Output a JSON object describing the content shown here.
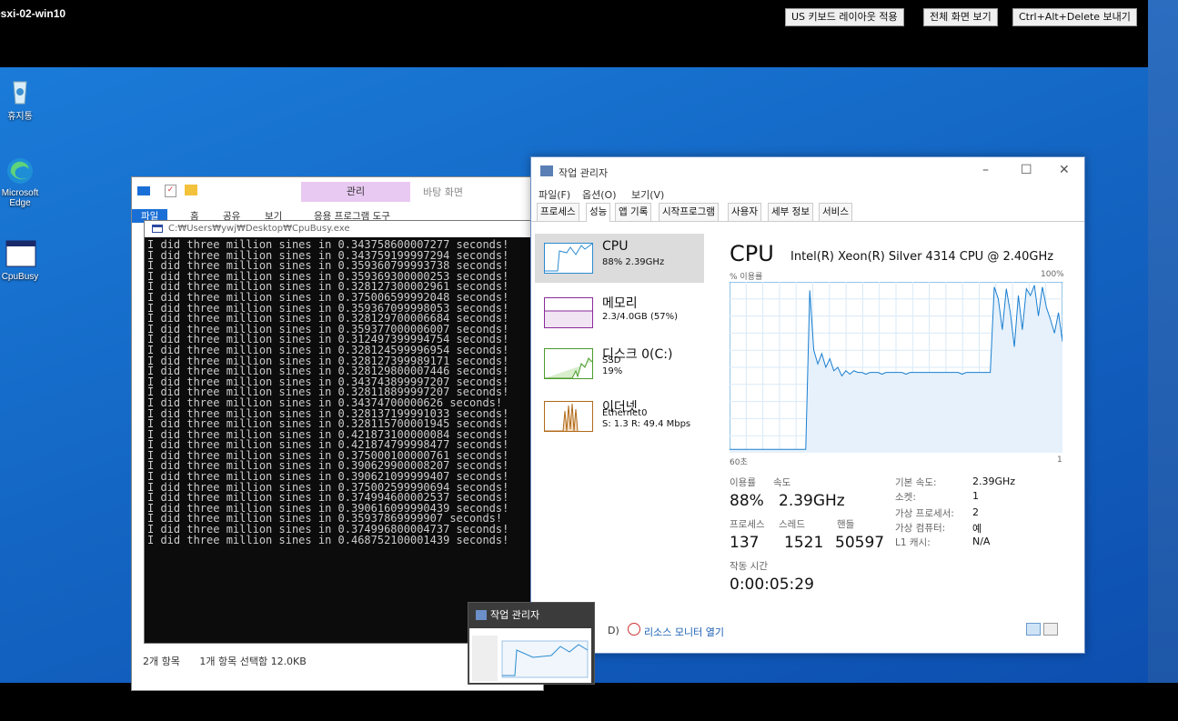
{
  "vm": {
    "title": "esxi-02-win10",
    "buttons": [
      "US 키보드 레이아웃 적용",
      "전체 화면 보기",
      "Ctrl+Alt+Delete 보내기"
    ]
  },
  "desktop": {
    "icons": [
      "휴지통",
      "Microsoft Edge",
      "CpuBusy"
    ]
  },
  "explorer": {
    "context_tab": "관리",
    "context_tab2": "바탕 화면",
    "ribbon_tabs": [
      "파일",
      "홈",
      "공유",
      "보기",
      "응용 프로그램 도구"
    ],
    "status_items": "2개 항목",
    "status_selected": "1개 항목 선택함 12.0KB"
  },
  "console": {
    "title": "C:₩Users₩ywj₩Desktop₩CpuBusy.exe",
    "lines": [
      "I did three million sines in 0.343758600007277 seconds!",
      "I did three million sines in 0.343759199997294 seconds!",
      "I did three million sines in 0.359360799993738 seconds!",
      "I did three million sines in 0.359369300000253 seconds!",
      "I did three million sines in 0.328127300002961 seconds!",
      "I did three million sines in 0.375006599992048 seconds!",
      "I did three million sines in 0.359367099998053 seconds!",
      "I did three million sines in 0.328129700006684 seconds!",
      "I did three million sines in 0.359377000006007 seconds!",
      "I did three million sines in 0.312497399994754 seconds!",
      "I did three million sines in 0.328124599996954 seconds!",
      "I did three million sines in 0.328127399989171 seconds!",
      "I did three million sines in 0.328129800007446 seconds!",
      "I did three million sines in 0.343743899997207 seconds!",
      "I did three million sines in 0.328118899997207 seconds!",
      "I did three million sines in 0.34374700000626 seconds!",
      "I did three million sines in 0.328137199991033 seconds!",
      "I did three million sines in 0.328115700001945 seconds!",
      "I did three million sines in 0.421873100000084 seconds!",
      "I did three million sines in 0.421874799998477 seconds!",
      "I did three million sines in 0.375000100000761 seconds!",
      "I did three million sines in 0.390629900008207 seconds!",
      "I did three million sines in 0.390621099999407 seconds!",
      "I did three million sines in 0.375002599990694 seconds!",
      "I did three million sines in 0.374994600002537 seconds!",
      "I did three million sines in 0.390616099990439 seconds!",
      "I did three million sines in 0.35937869999907 seconds!",
      "I did three million sines in 0.374996800004737 seconds!",
      "I did three million sines in 0.468752100001439 seconds!"
    ]
  },
  "taskmgr": {
    "title": "작업 관리자",
    "menu": [
      "파일(F)",
      "옵션(O)",
      "보기(V)"
    ],
    "tabs": [
      "프로세스",
      "성능",
      "앱 기록",
      "시작프로그램",
      "사용자",
      "세부 정보",
      "서비스"
    ],
    "active_tab": "성능",
    "sidebar": [
      {
        "name": "CPU",
        "sub": "88% 2.39GHz"
      },
      {
        "name": "메모리",
        "sub": "2.3/4.0GB (57%)"
      },
      {
        "name": "디스크 0(C:)",
        "sub": "SSD",
        "sub2": "19%"
      },
      {
        "name": "이더넷",
        "sub": "Ethernet0",
        "sub2": "S: 1.3 R: 49.4 Mbps"
      }
    ],
    "cpu_heading": "CPU",
    "cpu_model": "Intel(R) Xeon(R) Silver 4314 CPU @ 2.40GHz",
    "graph_label_left": "% 이용률",
    "graph_label_right": "100%",
    "graph_time_left": "60초",
    "graph_time_right": "1",
    "stats": {
      "util_label": "이용률",
      "speed_label": "속도",
      "util": "88%",
      "speed": "2.39GHz",
      "proc_label": "프로세스",
      "thread_label": "스레드",
      "handle_label": "핸들",
      "procs": "137",
      "threads": "1521",
      "handles": "50597",
      "uptime_label": "작동 시간",
      "uptime": "0:00:05:29"
    },
    "details": [
      {
        "k": "기본 속도:",
        "v": "2.39GHz"
      },
      {
        "k": "소켓:",
        "v": "1"
      },
      {
        "k": "가상 프로세서:",
        "v": "2"
      },
      {
        "k": "가상 컴퓨터:",
        "v": "예"
      },
      {
        "k": "L1 캐시:",
        "v": "N/A"
      }
    ],
    "footer_left": "D)",
    "footer_link": "리소스 모니터 열기",
    "cpu_graph": [
      2,
      2,
      2,
      2,
      2,
      2,
      2,
      2,
      2,
      2,
      2,
      2,
      2,
      2,
      2,
      2,
      2,
      2,
      2,
      2,
      95,
      60,
      52,
      58,
      50,
      55,
      48,
      50,
      45,
      48,
      46,
      48,
      47,
      47,
      46,
      47,
      47,
      47,
      46,
      47,
      47,
      47,
      47,
      47,
      46,
      47,
      47,
      47,
      47,
      47,
      47,
      47,
      47,
      47,
      47,
      47,
      47,
      47,
      46,
      47,
      47,
      47,
      47,
      47,
      47,
      47,
      97,
      90,
      72,
      96,
      82,
      62,
      92,
      72,
      96,
      92,
      98,
      80,
      97,
      85,
      78,
      70,
      82,
      65
    ]
  },
  "popup": {
    "title": "작업 관리자"
  }
}
